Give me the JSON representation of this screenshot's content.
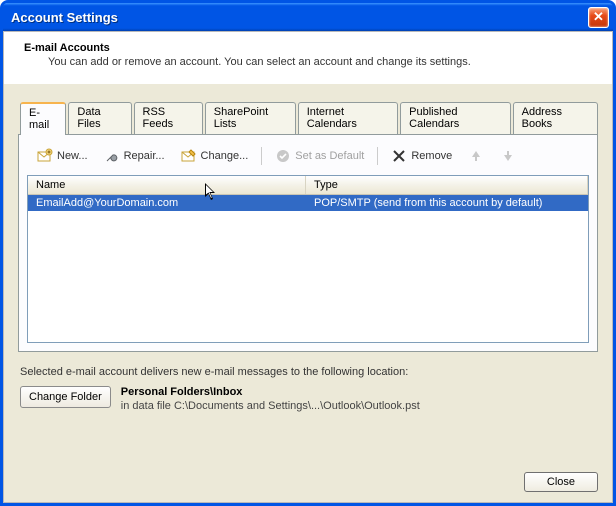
{
  "window": {
    "title": "Account Settings"
  },
  "header": {
    "heading": "E-mail Accounts",
    "subheading": "You can add or remove an account. You can select an account and change its settings."
  },
  "tabs": [
    {
      "label": "E-mail",
      "active": true
    },
    {
      "label": "Data Files"
    },
    {
      "label": "RSS Feeds"
    },
    {
      "label": "SharePoint Lists"
    },
    {
      "label": "Internet Calendars"
    },
    {
      "label": "Published Calendars"
    },
    {
      "label": "Address Books"
    }
  ],
  "toolbar": {
    "new": "New...",
    "repair": "Repair...",
    "change": "Change...",
    "set_default": "Set as Default",
    "remove": "Remove"
  },
  "columns": {
    "name": "Name",
    "type": "Type"
  },
  "accounts": [
    {
      "name": "EmailAdd@YourDomain.com",
      "type": "POP/SMTP (send from this account by default)",
      "selected": true
    }
  ],
  "delivery": {
    "intro": "Selected e-mail account delivers new e-mail messages to the following location:",
    "button": "Change Folder",
    "location_name": "Personal Folders\\Inbox",
    "location_path": "in data file C:\\Documents and Settings\\...\\Outlook\\Outlook.pst"
  },
  "footer": {
    "close": "Close"
  },
  "colors": {
    "accent": "#0055e5",
    "selection": "#316ac5",
    "tab_active_border": "#f7b44e"
  }
}
